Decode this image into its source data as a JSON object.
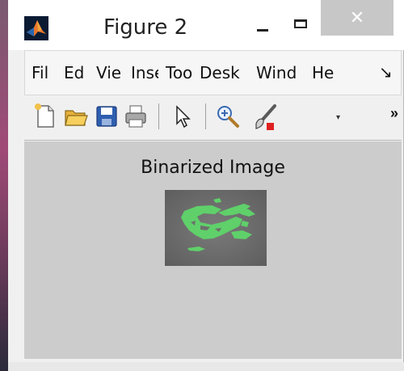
{
  "window": {
    "title": "Figure 2",
    "close_glyph": "✕"
  },
  "menu": {
    "items": [
      {
        "label": "Fil"
      },
      {
        "label": "Ed"
      },
      {
        "label": "Vie"
      },
      {
        "label": "Inse"
      },
      {
        "label": "Too"
      },
      {
        "label": "Desk"
      },
      {
        "label": "Wind"
      },
      {
        "label": "He"
      }
    ],
    "more_glyph": "↘"
  },
  "toolbar": {
    "icons": [
      "new-file-icon",
      "open-folder-icon",
      "save-disk-icon",
      "print-icon",
      "pointer-arrow-icon",
      "zoom-in-icon",
      "data-brush-icon"
    ],
    "dropdown_glyph": "▾",
    "more_glyph": "»"
  },
  "axes": {
    "title": "Binarized Image"
  },
  "colors": {
    "canvas_bg": "#cccccc",
    "image_bg": "#6e6e6e",
    "binary_region": "#5fd06a",
    "matlab_orange": "#e8762b"
  }
}
